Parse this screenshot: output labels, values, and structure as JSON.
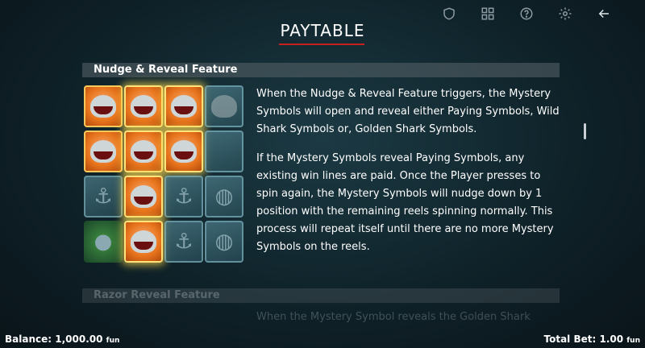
{
  "header": {
    "title": "PAYTABLE",
    "icons": [
      "shield-icon",
      "grid-icon",
      "help-icon",
      "settings-icon",
      "back-arrow-icon"
    ]
  },
  "sections": [
    {
      "title": "Nudge & Reveal Feature",
      "paragraphs": [
        "When the Nudge & Reveal Feature triggers, the Mystery Symbols will open and reveal either Paying Symbols, Wild Shark Symbols or, Golden Shark Symbols.",
        "If the Mystery Symbols reveal Paying Symbols, any existing win lines are paid. Once the Player presses to spin again, the Mystery Symbols will nudge down by 1 position with the remaining reels spinning normally. This process will repeat itself until there are no more Mystery Symbols on the reels."
      ]
    },
    {
      "title": "Razor Reveal Feature",
      "paragraphs": [
        "When the Mystery Symbol reveals the Golden Shark"
      ]
    }
  ],
  "footer": {
    "balance_label": "Balance:",
    "balance_value": "1,000.00",
    "balance_unit": "fun",
    "bet_label": "Total Bet:",
    "bet_value": "1.00",
    "bet_unit": "fun"
  },
  "colors": {
    "accent_underline": "#c8201e",
    "background": "#0f2229"
  }
}
